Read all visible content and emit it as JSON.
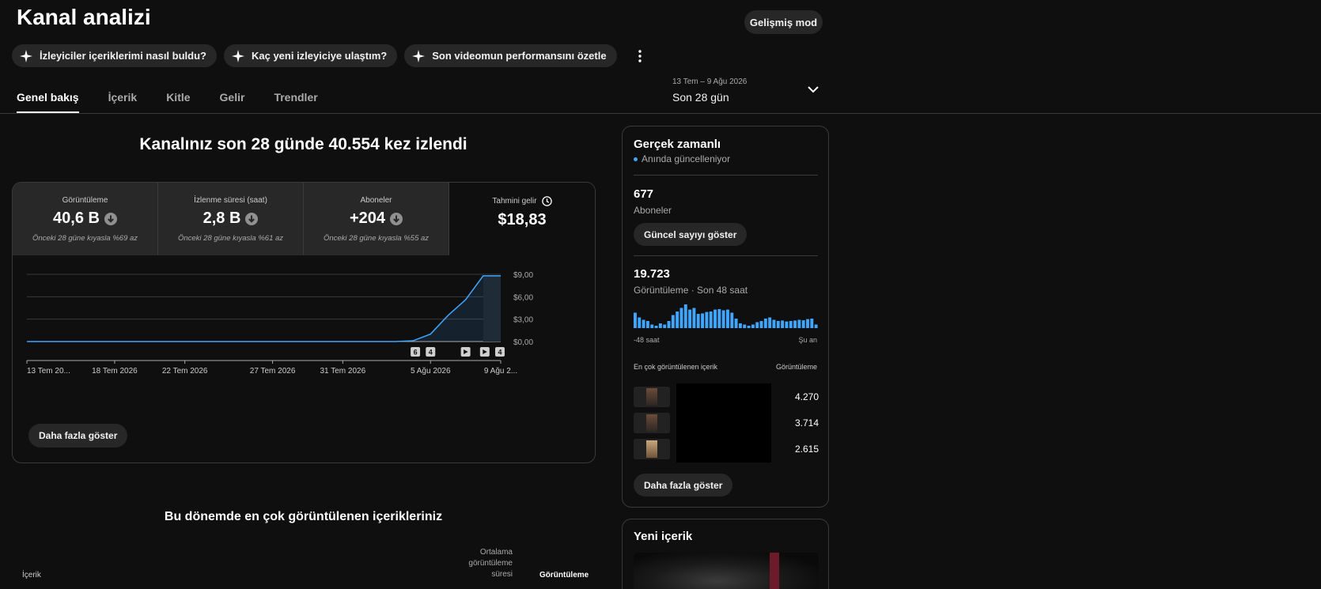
{
  "header": {
    "title": "Kanal analizi",
    "advanced_mode": "Gelişmiş mod"
  },
  "chips": [
    {
      "label": "İzleyiciler içeriklerimi nasıl buldu?",
      "icon": "sparkle-icon"
    },
    {
      "label": "Kaç yeni izleyiciye ulaştım?",
      "icon": "sparkle-icon"
    },
    {
      "label": "Son videomun performansını özetle",
      "icon": "sparkle-icon"
    }
  ],
  "tabs": [
    {
      "label": "Genel bakış",
      "active": true
    },
    {
      "label": "İçerik",
      "active": false
    },
    {
      "label": "Kitle",
      "active": false
    },
    {
      "label": "Gelir",
      "active": false
    },
    {
      "label": "Trendler",
      "active": false
    }
  ],
  "date_range": {
    "range": "13 Tem – 9 Ağu 2026",
    "label": "Son 28 gün"
  },
  "overview": {
    "headline": "Kanalınız son 28 günde 40.554 kez izlendi",
    "metrics": [
      {
        "label": "Görüntüleme",
        "value": "40,6 B",
        "note": "Önceki 28 güne kıyasla %69 az"
      },
      {
        "label": "İzlenme süresi (saat)",
        "value": "2,8 B",
        "note": "Önceki 28 güne kıyasla %61 az"
      },
      {
        "label": "Aboneler",
        "value": "+204",
        "note": "Önceki 28 güne kıyasla %55 az"
      },
      {
        "label": "Tahmini gelir",
        "value": "$18,83"
      }
    ],
    "more_button": "Daha fazla göster"
  },
  "chart_data": {
    "type": "line",
    "title": "",
    "x_tick_labels": [
      "13 Tem 20...",
      "18 Tem 2026",
      "22 Tem 2026",
      "27 Tem 2026",
      "31 Tem 2026",
      "5 Ağu 2026",
      "9 Ağu 2..."
    ],
    "y_tick_labels": [
      "$9,00",
      "$6,00",
      "$3,00",
      "$0,00"
    ],
    "ylim": [
      0,
      9
    ],
    "series": [
      {
        "color": "#3ea6ff",
        "x": [
          "13 Tem",
          "14 Tem",
          "15 Tem",
          "16 Tem",
          "17 Tem",
          "18 Tem",
          "19 Tem",
          "20 Tem",
          "21 Tem",
          "22 Tem",
          "23 Tem",
          "24 Tem",
          "25 Tem",
          "26 Tem",
          "27 Tem",
          "28 Tem",
          "29 Tem",
          "30 Tem",
          "31 Tem",
          "1 Ağu",
          "2 Ağu",
          "3 Ağu",
          "4 Ağu",
          "5 Ağu",
          "6 Ağu",
          "7 Ağu",
          "8 Ağu",
          "9 Ağu"
        ],
        "values": [
          0,
          0,
          0,
          0,
          0,
          0,
          0,
          0,
          0,
          0,
          0,
          0,
          0,
          0,
          0,
          0,
          0,
          0,
          0,
          0,
          0,
          0,
          0.1,
          1.0,
          3.5,
          5.6,
          8.8,
          8.8
        ]
      }
    ],
    "markers": [
      {
        "label": "6",
        "type": "count"
      },
      {
        "label": "4",
        "type": "count"
      },
      {
        "label": "",
        "type": "video"
      },
      {
        "label": "",
        "type": "video"
      },
      {
        "label": "4",
        "type": "count"
      }
    ],
    "grid": true
  },
  "top_content": {
    "headline": "Bu dönemde en çok görüntülenen içerikleriniz",
    "col_content": "İçerik",
    "col_avg": "Ortalama görüntüleme süresi",
    "col_views": "Görüntüleme"
  },
  "realtime": {
    "title": "Gerçek zamanlı",
    "live": "Anında güncelleniyor",
    "subscribers": "677",
    "subscribers_label": "Aboneler",
    "show_count": "Güncel sayıyı göster",
    "views": "19.723",
    "views_label": "Görüntüleme · Son 48 saat",
    "bars": [
      0.65,
      0.45,
      0.35,
      0.3,
      0.15,
      0.1,
      0.2,
      0.15,
      0.3,
      0.55,
      0.7,
      0.85,
      1.0,
      0.78,
      0.85,
      0.6,
      0.62,
      0.68,
      0.7,
      0.78,
      0.8,
      0.75,
      0.78,
      0.65,
      0.4,
      0.2,
      0.15,
      0.1,
      0.15,
      0.25,
      0.3,
      0.4,
      0.45,
      0.35,
      0.3,
      0.32,
      0.28,
      0.3,
      0.32,
      0.35,
      0.33,
      0.38,
      0.4,
      0.15
    ],
    "axis_left": "-48 saat",
    "axis_right": "Şu an",
    "top_header_left": "En çok görüntülenen içerik",
    "top_header_right": "Görüntüleme",
    "top_items": [
      {
        "views": "4.270"
      },
      {
        "views": "3.714"
      },
      {
        "views": "2.615"
      }
    ],
    "more_button": "Daha fazla göster"
  },
  "new_content": {
    "title": "Yeni içerik"
  }
}
